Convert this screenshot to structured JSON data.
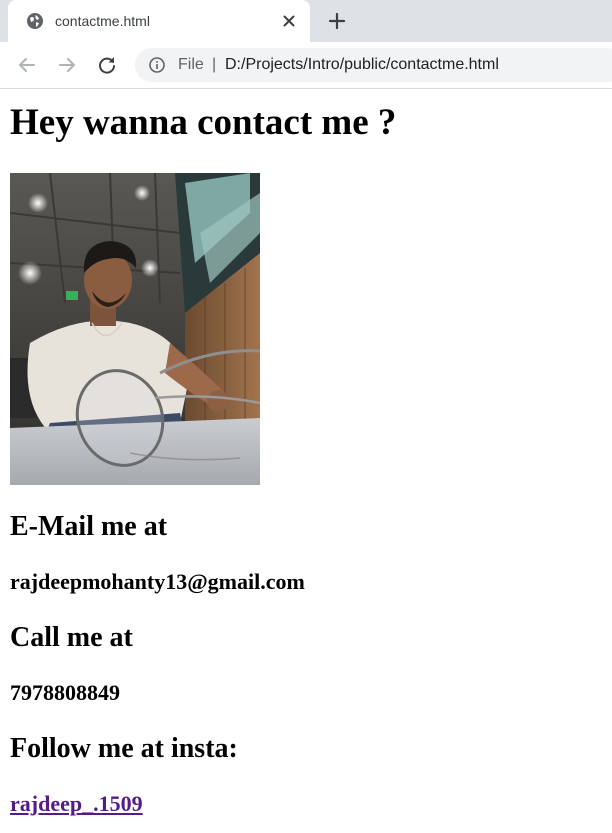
{
  "browser": {
    "tab_title": "contactme.html",
    "address_scheme": "File",
    "address_separator": "|",
    "address_url": "D:/Projects/Intro/public/contactme.html",
    "icons": {
      "favicon": "globe-icon",
      "close": "close-icon",
      "new_tab": "plus-icon",
      "back": "arrow-left-icon",
      "forward": "arrow-right-icon",
      "reload": "reload-icon",
      "info": "info-icon"
    }
  },
  "page": {
    "title": "Hey wanna contact me ?",
    "email_heading": "E-Mail me at",
    "email_value": "rajdeepmohanty13@gmail.com",
    "phone_heading": "Call me at",
    "phone_value": "7978808849",
    "insta_heading": "Follow me at insta:",
    "insta_link": "rajdeep_.1509"
  },
  "colors": {
    "tabstrip_bg": "#dee1e6",
    "omnibox_bg": "#f1f3f4",
    "visited_link": "#551a8b"
  }
}
